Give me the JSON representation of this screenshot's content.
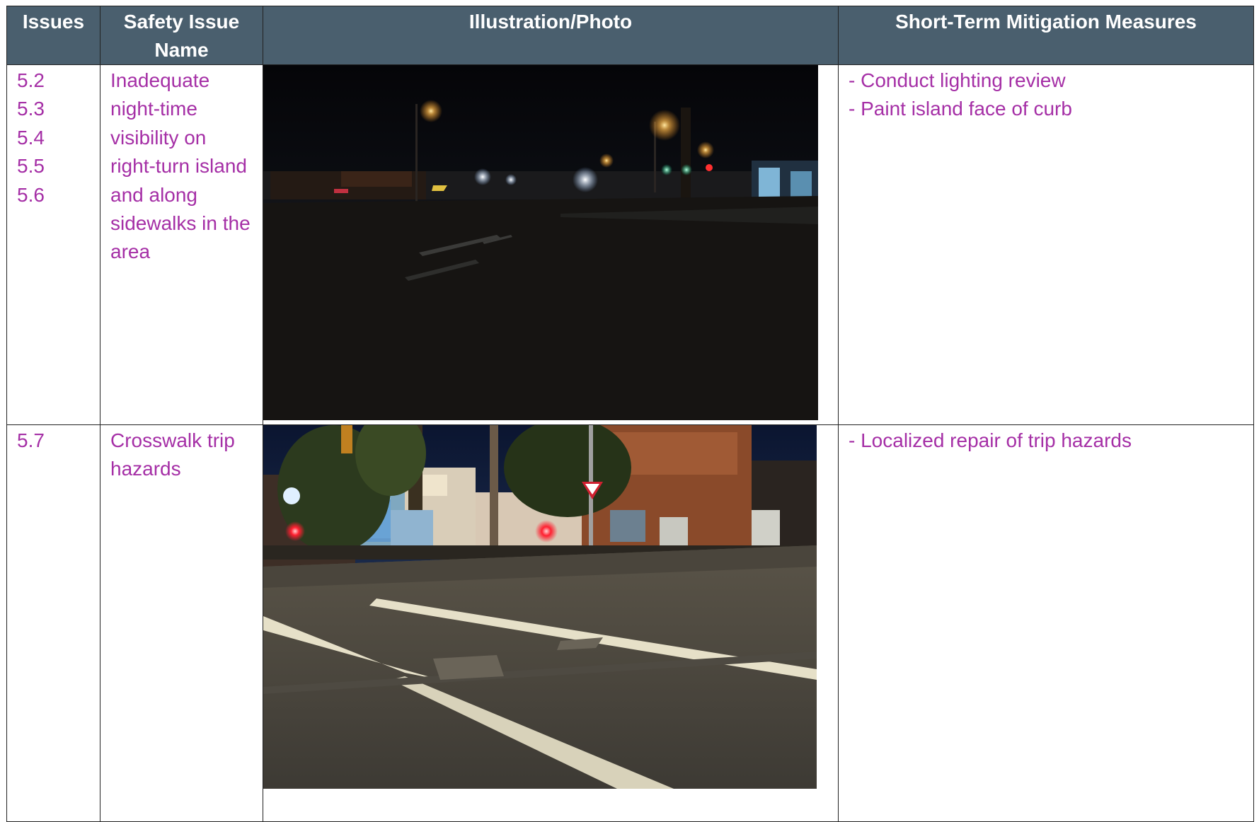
{
  "table": {
    "headers": {
      "issues": "Issues",
      "safety_issue_name": "Safety Issue Name",
      "illustration_photo": "Illustration/Photo",
      "mitigation": "Short-Term Mitigation Measures"
    },
    "rows": [
      {
        "issues": [
          "5.2",
          "5.3",
          "5.4",
          "5.5",
          "5.6"
        ],
        "name": "Inadequate night-time visibility on right-turn island and along sidewalks in the area",
        "photo_icon": "night-street-photo",
        "measures": [
          "- Conduct lighting review",
          "- Paint island face of curb"
        ]
      },
      {
        "issues": [
          "5.7"
        ],
        "name": "Crosswalk trip hazards",
        "photo_icon": "crosswalk-photo",
        "measures": [
          "- Localized repair of trip hazards"
        ]
      }
    ]
  },
  "colors": {
    "header_bg": "#4a5f6e",
    "header_text": "#ffffff",
    "body_text": "#a52fa6"
  }
}
